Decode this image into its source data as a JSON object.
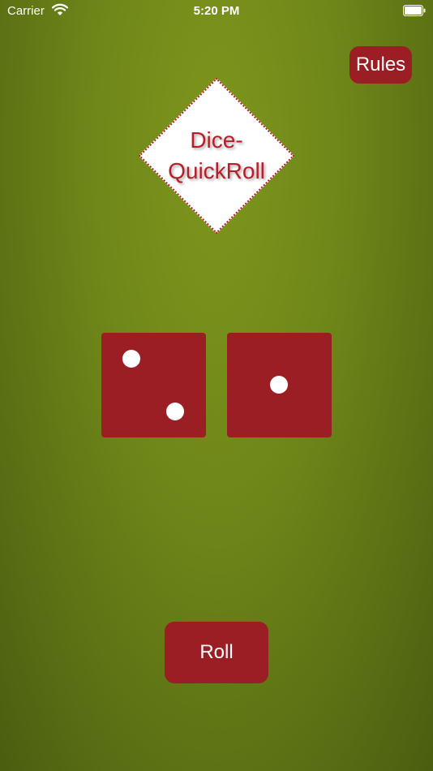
{
  "status_bar": {
    "carrier": "Carrier",
    "time": "5:20 PM"
  },
  "header": {
    "rules_label": "Rules"
  },
  "logo": {
    "line1": "Dice-",
    "line2": "QuickRoll"
  },
  "dice": [
    {
      "value": 2
    },
    {
      "value": 1
    }
  ],
  "controls": {
    "roll_label": "Roll"
  },
  "colors": {
    "felt": "#6f8719",
    "die": "#9b1e25",
    "logo_text": "#b3202a"
  }
}
